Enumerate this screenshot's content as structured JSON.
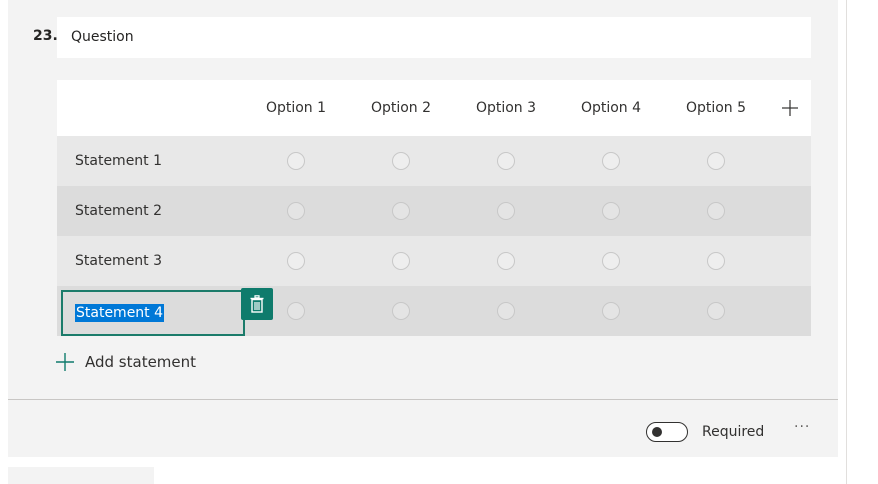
{
  "question": {
    "number": "23.",
    "title": "Question"
  },
  "grid": {
    "options": [
      "Option 1",
      "Option 2",
      "Option 3",
      "Option 4",
      "Option 5"
    ],
    "statements": [
      "Statement 1",
      "Statement 2",
      "Statement 3"
    ],
    "editing_statement": "Statement 4"
  },
  "add_statement_label": "Add statement",
  "required": {
    "label": "Required",
    "on": false
  },
  "more_label": "···",
  "colors": {
    "accent": "#0f7b6c",
    "selection": "#0078d7",
    "card_bg": "#f3f3f3",
    "row_odd": "#e8e8e8",
    "row_even": "#dcdcdc"
  }
}
